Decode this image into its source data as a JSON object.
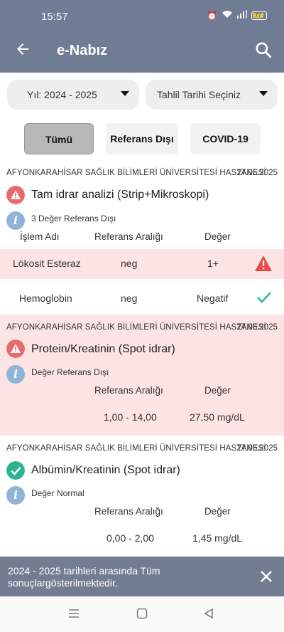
{
  "status_bar": {
    "time": "15:57",
    "battery": "77"
  },
  "app_bar": {
    "title": "e-Nabız"
  },
  "filters": {
    "year": "Yıl: 2024 - 2025",
    "date": "Tahlil Tarihi Seçiniz"
  },
  "tabs": [
    {
      "label": "Tümü",
      "active": true
    },
    {
      "label": "Referans Dışı"
    },
    {
      "label": "COVID-19"
    }
  ],
  "results": [
    {
      "hospital": "AFYONKARAHİSAR SAĞLIK BİLİMLERİ ÜNİVERSİTESİ HASTANESİ",
      "date": "27.06.2025",
      "test": "Tam idrar analizi (Strip+Mikroskopi)",
      "summary": "3 Değer Referans Dışı",
      "headers": {
        "name": "İşlem Adı",
        "range": "Referans Aralığı",
        "value": "Değer"
      },
      "rows": [
        {
          "name": "Lökosit Esteraz",
          "range": "neg",
          "value": "1+",
          "status": "abnormal"
        },
        {
          "name": "Hemoglobin",
          "range": "neg",
          "value": "Negatif",
          "status": "normal"
        }
      ]
    },
    {
      "hospital": "AFYONKARAHİSAR SAĞLIK BİLİMLERİ ÜNİVERSİTESİ HASTANESİ",
      "date": "27.06.2025",
      "test": "Protein/Kreatinin (Spot idrar)",
      "summary": "Değer Referans Dışı",
      "headers": {
        "range": "Referans Aralığı",
        "value": "Değer"
      },
      "range": "1,00 - 14,00",
      "value": "27,50 mg/dL"
    },
    {
      "hospital": "AFYONKARAHİSAR SAĞLIK BİLİMLERİ ÜNİVERSİTESİ HASTANESİ",
      "date": "27.06.2025",
      "test": "Albümin/Kreatinin (Spot idrar)",
      "summary": "Değer Normal",
      "headers": {
        "range": "Referans Aralığı",
        "value": "Değer"
      },
      "range": "0,00 - 2,00",
      "value": "1,45 mg/dL"
    }
  ],
  "toast": {
    "message": "2024 - 2025 tarihleri arasında Tüm sonuçlargösterilmektedir."
  },
  "colors": {
    "header": "#707b94",
    "abnormal_bg": "#fde4e4",
    "warning": "#e85858",
    "ok": "#2bb58c",
    "info": "#8fb4d8"
  }
}
